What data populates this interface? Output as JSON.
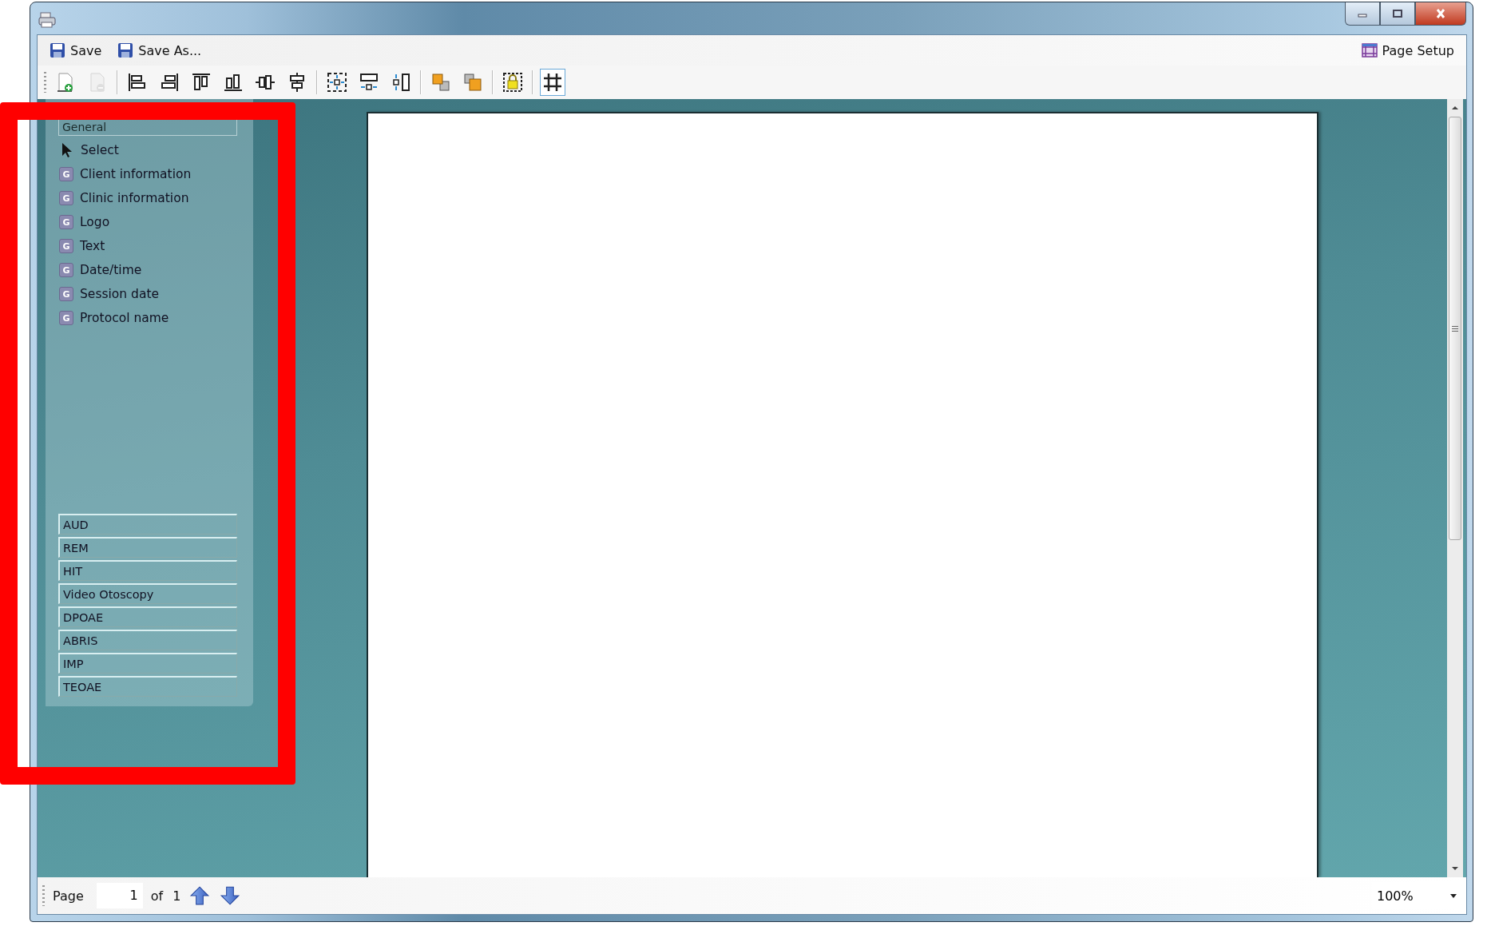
{
  "menu": [
    {
      "label": "Save",
      "kind": "save"
    },
    {
      "label": "Save As...",
      "kind": "save"
    }
  ],
  "page_setup": {
    "label": "Page Setup"
  },
  "toolbar": [
    [
      {
        "kind": "add-page",
        "disabled": false,
        "selected": false
      },
      {
        "kind": "remove-page",
        "disabled": true,
        "selected": false
      }
    ],
    [
      {
        "kind": "align-left",
        "disabled": false,
        "selected": false
      },
      {
        "kind": "align-right",
        "disabled": false,
        "selected": false
      },
      {
        "kind": "align-top",
        "disabled": false,
        "selected": false
      },
      {
        "kind": "align-bottom",
        "disabled": false,
        "selected": false
      },
      {
        "kind": "center-horizontal",
        "disabled": false,
        "selected": false
      },
      {
        "kind": "center-vertical",
        "disabled": false,
        "selected": false
      }
    ],
    [
      {
        "kind": "size-both",
        "disabled": false,
        "selected": false
      },
      {
        "kind": "size-width",
        "disabled": false,
        "selected": false
      },
      {
        "kind": "size-height",
        "disabled": false,
        "selected": false
      }
    ],
    [
      {
        "kind": "bring-front",
        "disabled": false,
        "selected": false
      },
      {
        "kind": "send-back",
        "disabled": false,
        "selected": false
      }
    ],
    [
      {
        "kind": "lock",
        "disabled": false,
        "selected": false
      }
    ],
    [
      {
        "kind": "grid",
        "disabled": false,
        "selected": true
      }
    ]
  ],
  "palette": {
    "header": "General",
    "items": [
      {
        "label": "Select",
        "kind": "pointer"
      },
      {
        "label": "Client information",
        "kind": "field",
        "badge": "G"
      },
      {
        "label": "Clinic information",
        "kind": "field",
        "badge": "G"
      },
      {
        "label": "Logo",
        "kind": "field",
        "badge": "G"
      },
      {
        "label": "Text",
        "kind": "field",
        "badge": "G"
      },
      {
        "label": "Date/time",
        "kind": "field",
        "badge": "G"
      },
      {
        "label": "Session date",
        "kind": "field",
        "badge": "G"
      },
      {
        "label": "Protocol name",
        "kind": "field",
        "badge": "G"
      }
    ],
    "groups": [
      "AUD",
      "REM",
      "HIT",
      "Video Otoscopy",
      "DPOAE",
      "ABRIS",
      "IMP",
      "TEOAE"
    ]
  },
  "pager": {
    "label": "Page",
    "value": "1",
    "of": "of",
    "total": "1"
  },
  "zoom": {
    "value": "100%"
  }
}
